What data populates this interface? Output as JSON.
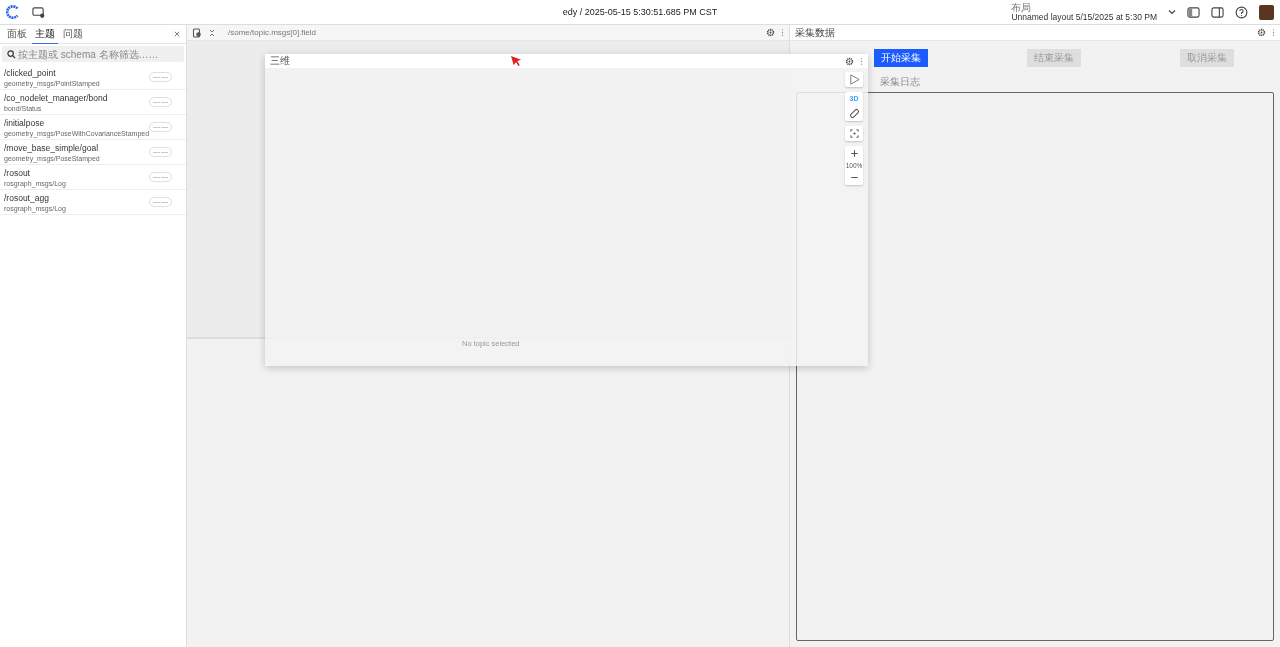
{
  "header": {
    "title": "edy / 2025-05-15 5:30:51.685 PM CST",
    "layout_label": "布局",
    "layout_name": "Unnamed layout 5/15/2025 at 5:30 PM"
  },
  "sidebar": {
    "tabs": [
      {
        "label": "面板",
        "selected": false
      },
      {
        "label": "主题",
        "selected": true
      },
      {
        "label": "问题",
        "selected": false
      }
    ],
    "search": {
      "placeholder": "按主题或 schema 名称筛选……"
    },
    "topics": [
      {
        "name": "/clicked_point",
        "type": "geometry_msgs/PointStamped",
        "stats": [
          "—",
          "—"
        ]
      },
      {
        "name": "/co_nodelet_manager/bond",
        "type": "bond/Status",
        "stats": [
          "—",
          "—"
        ]
      },
      {
        "name": "/initialpose",
        "type": "geometry_msgs/PoseWithCovarianceStamped",
        "stats": [
          "—",
          "—"
        ]
      },
      {
        "name": "/move_base_simple/goal",
        "type": "geometry_msgs/PoseStamped",
        "stats": [
          "—",
          "—"
        ]
      },
      {
        "name": "/rosout",
        "type": "rosgraph_msgs/Log",
        "stats": [
          "—",
          "—"
        ]
      },
      {
        "name": "/rosout_agg",
        "type": "rosgraph_msgs/Log",
        "stats": [
          "—",
          "—"
        ]
      }
    ]
  },
  "plot_panel": {
    "path": "/some/topic.msgs[0].field"
  },
  "capture_panel": {
    "title": "采集数据",
    "buttons": [
      {
        "label": "开始采集",
        "disabled": false
      },
      {
        "label": "结束采集",
        "disabled": true
      },
      {
        "label": "取消采集",
        "disabled": true
      }
    ],
    "log_label": "采集日志"
  },
  "floating_panel": {
    "title": "三维",
    "mode": "3D",
    "zoom": "100%",
    "empty_message": "No topic selected"
  }
}
